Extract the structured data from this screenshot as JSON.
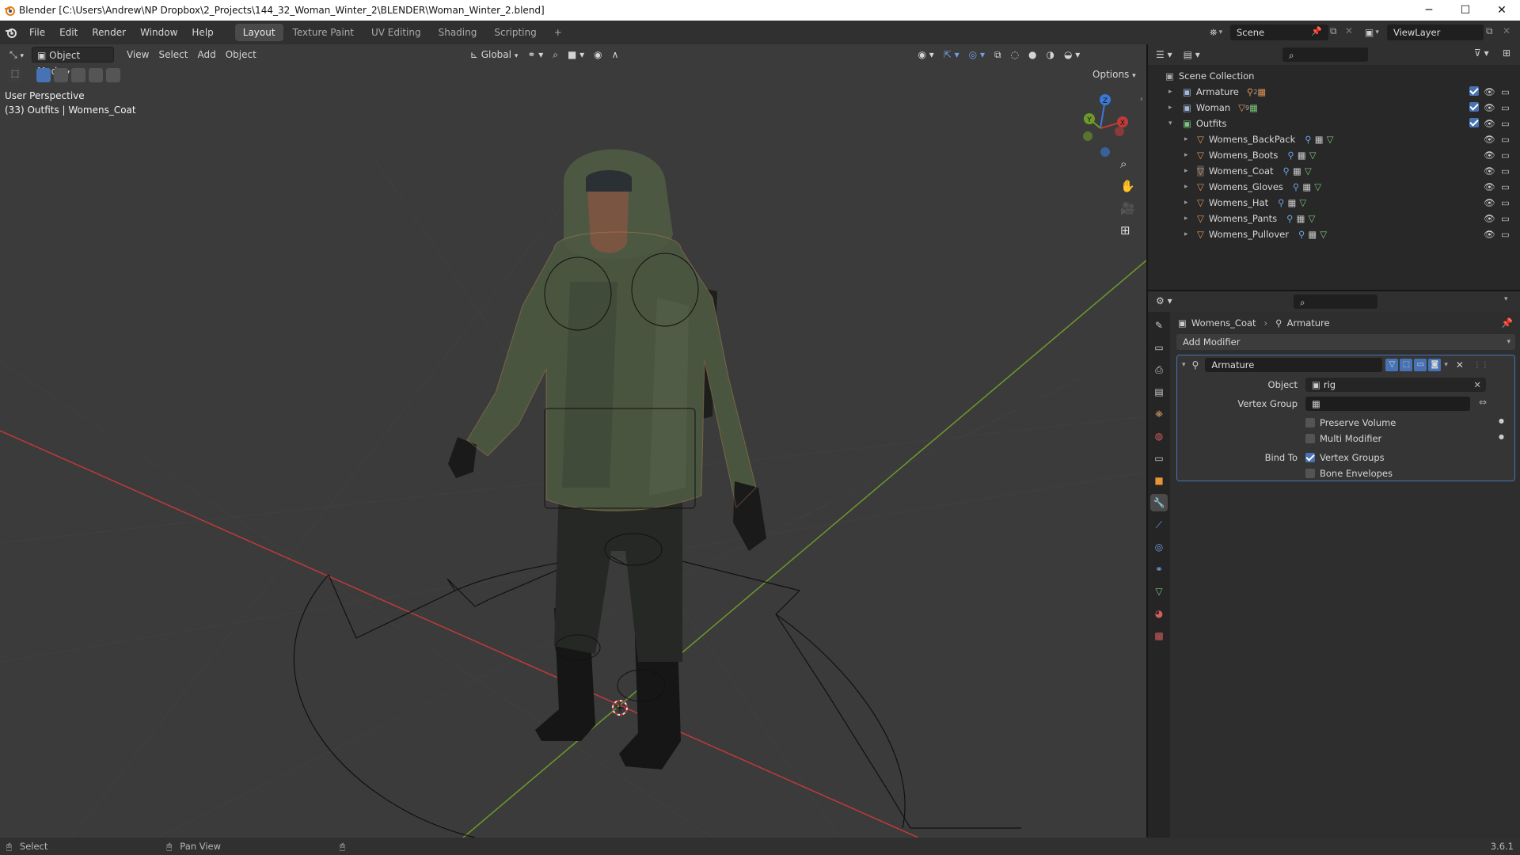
{
  "window": {
    "title": "Blender [C:\\Users\\Andrew\\NP Dropbox\\2_Projects\\144_32_Woman_Winter_2\\BLENDER\\Woman_Winter_2.blend]",
    "minimize": "─",
    "maximize": "☐",
    "close": "✕"
  },
  "menubar": {
    "items": [
      "File",
      "Edit",
      "Render",
      "Window",
      "Help"
    ],
    "tabs": [
      "Layout",
      "Texture Paint",
      "UV Editing",
      "Shading",
      "Scripting"
    ],
    "add_tab": "+",
    "scene_label": "Scene",
    "viewlayer_label": "ViewLayer"
  },
  "viewport": {
    "mode": "Object Mode",
    "menus": [
      "View",
      "Select",
      "Add",
      "Object"
    ],
    "orientation": "Global",
    "options": "Options",
    "perspective": "User Perspective",
    "context": "(33) Outfits | Womens_Coat",
    "gizmo": {
      "x": "X",
      "y": "Y",
      "z": "Z"
    }
  },
  "outliner": {
    "root": "Scene Collection",
    "collections": [
      {
        "name": "Armature",
        "expanded": false,
        "sub": "2"
      },
      {
        "name": "Woman",
        "expanded": false,
        "sub": "9"
      },
      {
        "name": "Outfits",
        "expanded": true
      }
    ],
    "objects": [
      "Womens_BackPack",
      "Womens_Boots",
      "Womens_Coat",
      "Womens_Gloves",
      "Womens_Hat",
      "Womens_Pants",
      "Womens_Pullover"
    ],
    "active_object": "Womens_Coat"
  },
  "properties": {
    "breadcrumb_object": "Womens_Coat",
    "breadcrumb_modifier": "Armature",
    "add_modifier": "Add Modifier",
    "modifier": {
      "name": "Armature",
      "object_label": "Object",
      "object_value": "rig",
      "vertex_group_label": "Vertex Group",
      "vertex_group_value": "",
      "preserve_volume": {
        "label": "Preserve Volume",
        "checked": false
      },
      "multi_modifier": {
        "label": "Multi Modifier",
        "checked": false
      },
      "bind_to_label": "Bind To",
      "vertex_groups": {
        "label": "Vertex Groups",
        "checked": true
      },
      "bone_envelopes": {
        "label": "Bone Envelopes",
        "checked": false
      }
    }
  },
  "statusbar": {
    "select": "Select",
    "pan_view": "Pan View",
    "version": "3.6.1"
  },
  "colors": {
    "viewport_bg": "#3b3b3b",
    "x_axis": "#c03a3a",
    "y_axis": "#6e9a2a",
    "accent": "#4772b3",
    "mesh_orange": "#e19658",
    "coat": "#4a5540"
  }
}
